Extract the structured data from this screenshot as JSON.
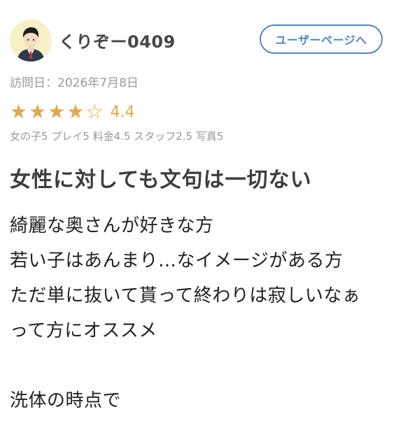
{
  "header": {
    "username": "くりぞー0409",
    "user_page_button": "ユーザーページへ",
    "avatar_icon": "user-avatar-icon"
  },
  "review": {
    "visit_date": "訪問日：2026年7月8日",
    "rating": {
      "value": 4.4,
      "value_label": "4.4",
      "filled_stars": 4,
      "total_stars": 5,
      "star_color": "#e2a84b"
    },
    "sub_ratings": "女の子5 プレイ5 料金4.5 スタッフ2.5 写真5",
    "title": "女性に対しても文句は一切ない",
    "body_lines": [
      "綺麗な奥さんが好きな方",
      "若い子はあんまり…なイメージがある方",
      "ただ単に抜いて貰って終わりは寂しいなぁ",
      "って方にオススメ",
      "",
      "洗体の時点で"
    ]
  },
  "colors": {
    "button_border": "#4f86c6",
    "muted_text": "#9a9a9a",
    "avatar_bg": "#f6f1c7"
  }
}
